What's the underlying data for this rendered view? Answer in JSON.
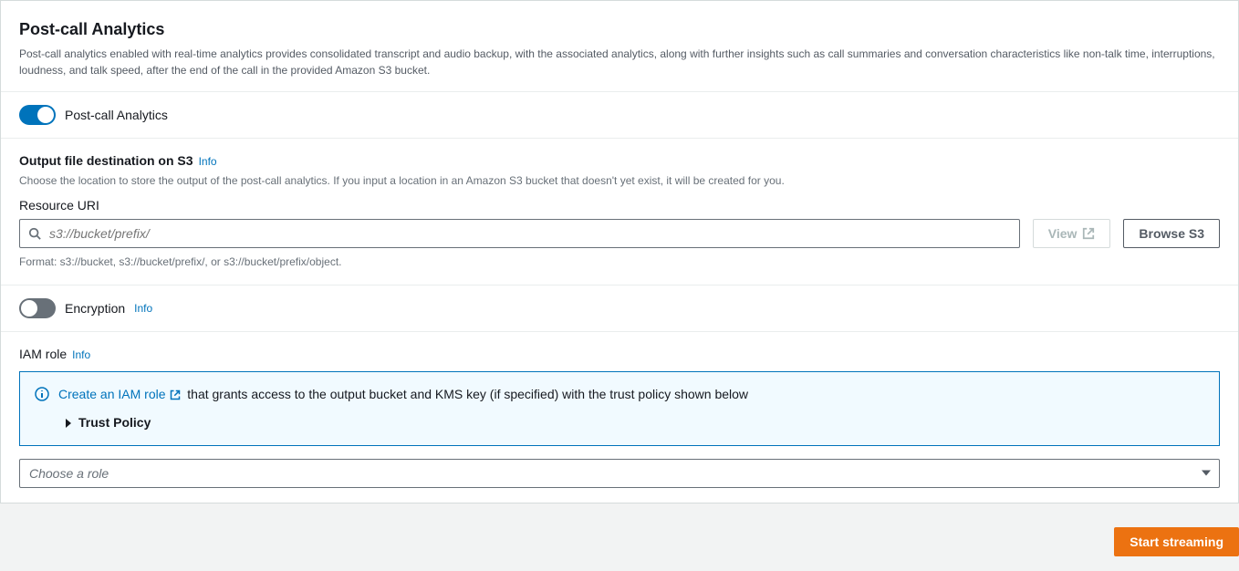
{
  "header": {
    "title": "Post-call Analytics",
    "description": "Post-call analytics enabled with real-time analytics provides consolidated transcript and audio backup, with the associated analytics, along with further insights such as call summaries and conversation characteristics like non-talk time, interruptions, loudness, and talk speed, after the end of the call in the provided Amazon S3 bucket."
  },
  "toggle": {
    "pca_label": "Post-call Analytics"
  },
  "output": {
    "label": "Output file destination on S3",
    "info": "Info",
    "hint": "Choose the location to store the output of the post-call analytics. If you input a location in an Amazon S3 bucket that doesn't yet exist, it will be created for you.",
    "resource_label": "Resource URI",
    "placeholder": "s3://bucket/prefix/",
    "value": "",
    "view_label": "View",
    "browse_label": "Browse S3",
    "format_hint": "Format: s3://bucket, s3://bucket/prefix/, or s3://bucket/prefix/object."
  },
  "encryption": {
    "label": "Encryption",
    "info": "Info"
  },
  "iam": {
    "label": "IAM role",
    "info": "Info",
    "create_link": "Create an IAM role",
    "create_text": "that grants access to the output bucket and KMS key (if specified) with the trust policy shown below",
    "trust_policy_label": "Trust Policy",
    "select_placeholder": "Choose a role"
  },
  "footer": {
    "start_label": "Start streaming"
  }
}
